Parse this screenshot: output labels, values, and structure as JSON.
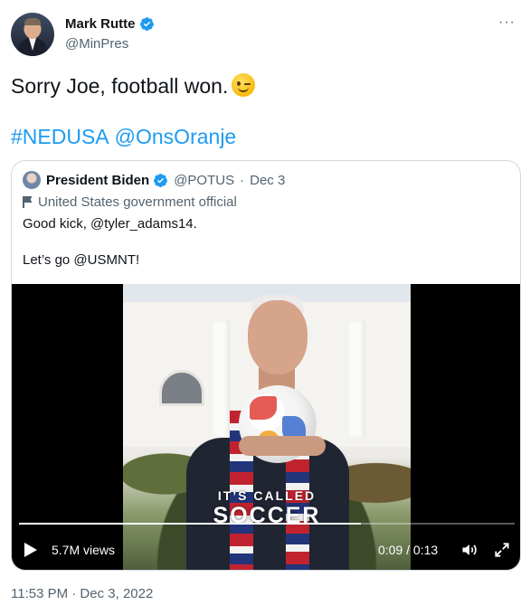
{
  "author": {
    "display_name": "Mark Rutte",
    "handle": "@MinPres",
    "verified": true
  },
  "more_icon": "···",
  "tweet": {
    "text": "Sorry Joe, football won.",
    "emoji": "winking-face",
    "hashtag": "#NEDUSA",
    "mention": "@OnsOranje",
    "timestamp": "11:53 PM · Dec 3, 2022"
  },
  "quoted_tweet": {
    "display_name": "President Biden",
    "handle": "@POTUS",
    "separator": "·",
    "date": "Dec 3",
    "label": "United States government official",
    "line1": "Good kick, @tyler_adams14.",
    "line2": "Let’s go @USMNT!"
  },
  "video": {
    "caption_small": "IT’S CALLED",
    "caption_big": "SOCCER",
    "views": "5.7M views",
    "time": "0:09 / 0:13",
    "progress": 0.69
  },
  "colors": {
    "accent": "#1d9bf0",
    "secondary_text": "#536471",
    "border": "#cfd9de"
  }
}
